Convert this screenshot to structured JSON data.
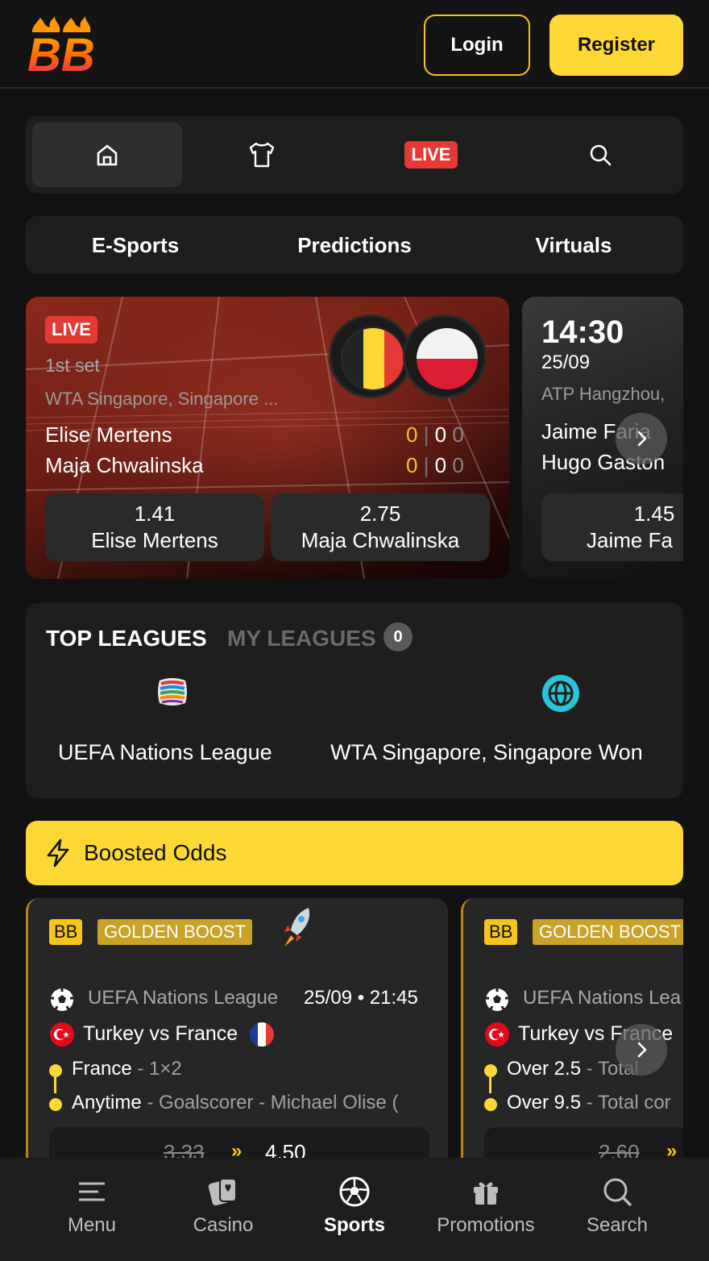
{
  "header": {
    "logo_text": "BB",
    "login_label": "Login",
    "register_label": "Register"
  },
  "top_nav": {
    "live_label": "LIVE"
  },
  "sub_nav": [
    "E-Sports",
    "Predictions",
    "Virtuals"
  ],
  "live_matches": [
    {
      "status": "LIVE",
      "period": "1st set",
      "league": "WTA Singapore, Singapore ...",
      "home": "Elise Mertens",
      "away": "Maja Chwalinska",
      "home_score": [
        "0",
        "0",
        "0"
      ],
      "away_score": [
        "0",
        "0",
        "0"
      ],
      "odds": [
        {
          "value": "1.41",
          "name": "Elise Mertens"
        },
        {
          "value": "2.75",
          "name": "Maja Chwalinska"
        }
      ]
    },
    {
      "time": "14:30",
      "date": "25/09",
      "league": "ATP Hangzhou,",
      "home": "Jaime Faria",
      "away": "Hugo Gaston",
      "odds": [
        {
          "value": "1.45",
          "name": "Jaime Fa"
        }
      ]
    }
  ],
  "leagues": {
    "top_label": "TOP LEAGUES",
    "my_label": "MY LEAGUES",
    "my_count": "0",
    "items": [
      "UEFA Nations League",
      "WTA Singapore, Singapore Won"
    ]
  },
  "boosted": {
    "title": "Boosted Odds",
    "cards": [
      {
        "bb": "BB",
        "badge": "GOLDEN BOOST",
        "league": "UEFA Nations League",
        "date": "25/09 • 21:45",
        "match": "Turkey vs France",
        "sel1": "France",
        "sel1_sep": " - ",
        "sel1_market": "1×2",
        "sel2": "Anytime",
        "sel2_sep": " - ",
        "sel2_market": "Goalscorer - Michael Olise (",
        "old_odds": "3.33",
        "arrows": "»",
        "new_odds": "4.50"
      },
      {
        "bb": "BB",
        "badge": "GOLDEN BOOST",
        "league": "UEFA Nations Lea",
        "match": "Turkey vs France",
        "sel1": "Over 2.5",
        "sel1_sep": " - ",
        "sel1_market": "Total",
        "sel2": "Over 9.5",
        "sel2_sep": " - ",
        "sel2_market": "Total cor",
        "old_odds": "2.60",
        "arrows": "»"
      }
    ]
  },
  "bottom_nav": [
    "Menu",
    "Casino",
    "Sports",
    "Promotions",
    "Search"
  ],
  "colors": {
    "accent": "#fdd835",
    "live": "#e53935",
    "bg": "#121212",
    "panel": "#1e1e1e"
  }
}
